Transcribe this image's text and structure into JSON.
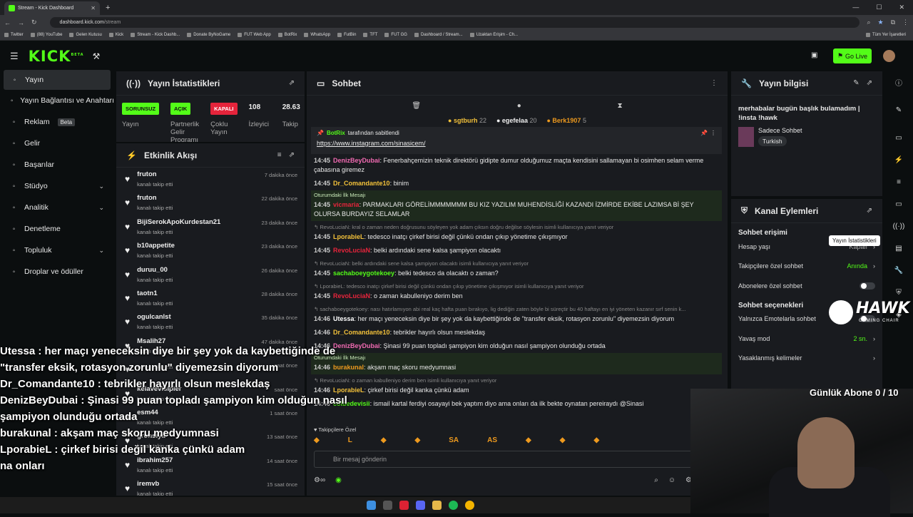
{
  "browser": {
    "tab_title": "Stream - Kick Dashboard",
    "url_host": "dashboard.kick.com",
    "url_path": "/stream",
    "bookmarks": [
      "Twitter",
      "(88) YouTube",
      "Gelen Kutusu",
      "Kick",
      "Stream - Kick Dashb...",
      "Donate ByNoGame",
      "FUT Web App",
      "BotRix",
      "WhatsApp",
      "FutBin",
      "TFT",
      "FUT GG",
      "Dashboard / Stream...",
      "Uzaktan Erişim - Ch..."
    ],
    "bookmarks_right": "Tüm Yer İşaretleri"
  },
  "topbar": {
    "logo": "KICK",
    "logo_beta": "BETA",
    "go_live": "Go Live"
  },
  "sidebar": [
    {
      "label": "Yayın",
      "icon": "broadcast-icon",
      "active": true
    },
    {
      "label": "Yayın Bağlantısı ve Anahtarı",
      "icon": "link-icon"
    },
    {
      "label": "Reklam",
      "icon": "ad-icon",
      "badge": "Beta"
    },
    {
      "label": "Gelir",
      "icon": "dollar-icon"
    },
    {
      "label": "Başarılar",
      "icon": "trophy-icon"
    },
    {
      "label": "Stüdyo",
      "icon": "studio-icon",
      "chevron": true
    },
    {
      "label": "Analitik",
      "icon": "chart-icon",
      "chevron": true
    },
    {
      "label": "Denetleme",
      "icon": "sword-icon"
    },
    {
      "label": "Topluluk",
      "icon": "community-icon",
      "chevron": true
    },
    {
      "label": "Droplar ve ödüller",
      "icon": "gift-icon"
    }
  ],
  "stats": {
    "title": "Yayın İstatistikleri",
    "items": [
      {
        "badge": "SORUNSUZ",
        "color": "#53fc18",
        "label": "Yayın"
      },
      {
        "badge": "AÇIK",
        "color": "#53fc18",
        "label": "Partnerlik Gelir Programı"
      },
      {
        "badge": "KAPALI",
        "color": "#e5243b",
        "label": "Çoklu Yayın"
      },
      {
        "num": "108",
        "label": "İzleyici"
      },
      {
        "num": "28.63",
        "label": "Takip"
      }
    ]
  },
  "feed": {
    "title": "Etkinlik Akışı",
    "items": [
      {
        "name": "fruton",
        "sub": "kanalı takip etti",
        "time": "7 dakika önce"
      },
      {
        "name": "fruton",
        "sub": "kanalı takip etti",
        "time": "22 dakika önce"
      },
      {
        "name": "BijiSerokApoKurdestan21",
        "sub": "kanalı takip etti",
        "time": "23 dakika önce"
      },
      {
        "name": "b10appetite",
        "sub": "kanalı takip etti",
        "time": "23 dakika önce"
      },
      {
        "name": "duruu_00",
        "sub": "kanalı takip etti",
        "time": "26 dakika önce"
      },
      {
        "name": "taotn1",
        "sub": "kanalı takip etti",
        "time": "28 dakika önce"
      },
      {
        "name": "ogulcanlst",
        "sub": "kanalı takip etti",
        "time": "35 dakika önce"
      },
      {
        "name": "Msalih27",
        "sub": "kanalı takip etti",
        "time": "47 dakika önce"
      },
      {
        "name": "",
        "sub": "kanalı takip etti",
        "time": "saat önce"
      },
      {
        "name": "kelavevisipier",
        "sub": "kanalı takip etti",
        "time": "saat önce"
      },
      {
        "name": "esm44",
        "sub": "kanalı takip etti",
        "time": "1 saat önce"
      },
      {
        "name": "gronsiya",
        "sub": "kanalı takip etti",
        "time": "13 saat önce"
      },
      {
        "name": "ibrahim257",
        "sub": "kanalı takip etti",
        "time": "14 saat önce"
      },
      {
        "name": "iremvb",
        "sub": "kanalı takip etti",
        "time": "15 saat önce"
      }
    ]
  },
  "chat": {
    "title": "Sohbet",
    "gifters": [
      {
        "name": "sgtburh",
        "count": "22",
        "color": "#f3c13a"
      },
      {
        "name": "egefelaa",
        "count": "20",
        "color": "#eeeeee"
      },
      {
        "name": "Berk1907",
        "count": "5",
        "color": "#ee9a1e"
      }
    ],
    "pinned_by": "BotRix",
    "pinned_suffix": "tarafından sabitlendi",
    "pinned_link": "https://www.instagram.com/sinasicem/",
    "first_label": "Oturumdaki İlk Mesajı",
    "messages": [
      {
        "time": "14:45",
        "user": "DenizBeyDubai",
        "color": "#f06ab1",
        "text": "Fenerbahçemizin teknik direktörü gidipte dumur olduğumuz maçta kendisini sallamayan bi osimhen selam verme çabasına giremez"
      },
      {
        "time": "14:45",
        "user": "Dr_Comandante10",
        "color": "#f3c13a",
        "text": "binim"
      },
      {
        "time": "14:45",
        "user": "vicmaria",
        "color": "#e5243b",
        "text": "PARMAKLARI GÖRELİMMMMMMM BU KIZ YAZILIM MUHENDİSLİĞİ KAZANDI İZMİRDE EKİBE LAZIMSA Bİ ŞEY OLURSA BURDAYIZ SELAMLAR",
        "first": true
      },
      {
        "reply": "RevoLuciaN: kral o zaman neden doğrusunu söyleyen yok adam çıksın doğru değilse söylesin isimli kullanıcıya yanıt veriyor",
        "time": "14:45",
        "user": "LporabieL",
        "color": "#f3c13a",
        "text": "tedesco inatçı çirkef birisi değil çünkü ondan çıkıp yönetime çıkışmıyor"
      },
      {
        "time": "14:45",
        "user": "RevoLuciaN",
        "color": "#e5243b",
        "text": "belki ardındaki sene kalsa şampiyon olacaktı"
      },
      {
        "reply": "RevoLuciaN: belki ardındaki sene kalsa şampiyon olacaktı isimli kullanıcıya yanıt veriyor",
        "time": "14:45",
        "user": "sachaboeygotekoey",
        "color": "#53fc18",
        "text": "belki tedesco da olacaktı o zaman?"
      },
      {
        "reply": "LporabieL: tedesco inatçı çirkef birisi değil çünkü ondan çıkıp yönetime çıkışmıyor isimli kullanıcıya yanıt veriyor",
        "time": "14:45",
        "user": "RevoLuciaN",
        "color": "#e5243b",
        "text": "o zaman kabulleniyo derim ben"
      },
      {
        "reply": "sachaboeygotekoey: nası hatırlamıyon abi real kaç hafta puan bırakıyo, lig dediğin zaten böyle bi süreçtir bu 40 haftayı en iyi yöneten kazanır sırf senin k...",
        "time": "14:46",
        "user": "Utessa",
        "color": "#ffffff",
        "text": "her maçı yeneceksin diye bir şey yok da kaybettiğinde de \"transfer eksik, rotasyon zorunlu\" diyemezsin diyorum"
      },
      {
        "time": "14:46",
        "user": "Dr_Comandante10",
        "color": "#f3c13a",
        "text": "tebrikler hayırlı olsun meslekdaş"
      },
      {
        "time": "14:46",
        "user": "DenizBeyDubai",
        "color": "#f06ab1",
        "text": "Şinasi 99 puan topladı şampiyon kim olduğun nasıl şampiyon olunduğu ortada"
      },
      {
        "time": "14:46",
        "user": "burakunal",
        "color": "#ee9a1e",
        "text": "akşam maç skoru medyumnasi",
        "first": true
      },
      {
        "reply": "RevoLuciaN: o zaman kabulleniyo derim ben isimli kullanıcıya yanıt veriyor",
        "time": "14:46",
        "user": "LporabieL",
        "color": "#f3c13a",
        "text": "çirkef birisi değil kanka çünkü adam"
      },
      {
        "time": "14:46",
        "user": "colbedevisii",
        "color": "#53fc18",
        "text": "ismail kartal ferdiyi osayayi bek yaptım diyo ama onları da ilk bekte oynatan pereiraydı @Sinasi"
      }
    ],
    "subs_only": "Takipçilere Özel",
    "emotes": [
      "",
      "L",
      "",
      "",
      "SA",
      "AS",
      "",
      "",
      ""
    ],
    "input_placeholder": "Bir mesaj gönderin"
  },
  "info": {
    "title": "Yayın bilgisi",
    "stream_title": "merhabalar bugün başlık bulamadım | !insta !hawk",
    "category": "Sadece Sohbet",
    "tag": "Turkish"
  },
  "actions": {
    "title": "Kanal Eylemleri",
    "access_title": "Sohbet erişimi",
    "rows1": [
      {
        "label": "Hesap yaşı",
        "value": "Kapalı",
        "chev": true
      },
      {
        "label": "Takipçilere özel sohbet",
        "value": "Anında",
        "chev": true
      },
      {
        "label": "Abonelere özel sohbet",
        "toggle": true
      }
    ],
    "options_title": "Sohbet seçenekleri",
    "rows2": [
      {
        "label": "Yalnızca Emotelarla sohbet",
        "toggle": true
      },
      {
        "label": "Yavaş mod",
        "value": "2 sn.",
        "chev": true
      },
      {
        "label": "Yasaklanmış kelimeler",
        "chev": true
      }
    ]
  },
  "tooltip": "Yayın İstatistikleri",
  "overlay": {
    "lines": [
      "Utessa : her maçı yeneceksin diye bir şey yok da kaybettiğinde de",
      "\"transfer eksik, rotasyon zorunlu\" diyemezsin diyorum",
      "Dr_Comandante10 : tebrikler hayırlı olsun meslekdaş",
      "DenizBeyDubai : Şinasi 99 puan topladı şampiyon kim olduğun nasıl",
      "şampiyon olunduğu ortada",
      "burakunal : akşam maç skoru medyumnasi",
      "LporabieL : çirkef birisi değil kanka çünkü adam",
      "na onları"
    ],
    "goal": "Günlük Abone 0 / 10",
    "hawk": "HAWK",
    "hawk_sub": "GAMING CHAIR"
  }
}
